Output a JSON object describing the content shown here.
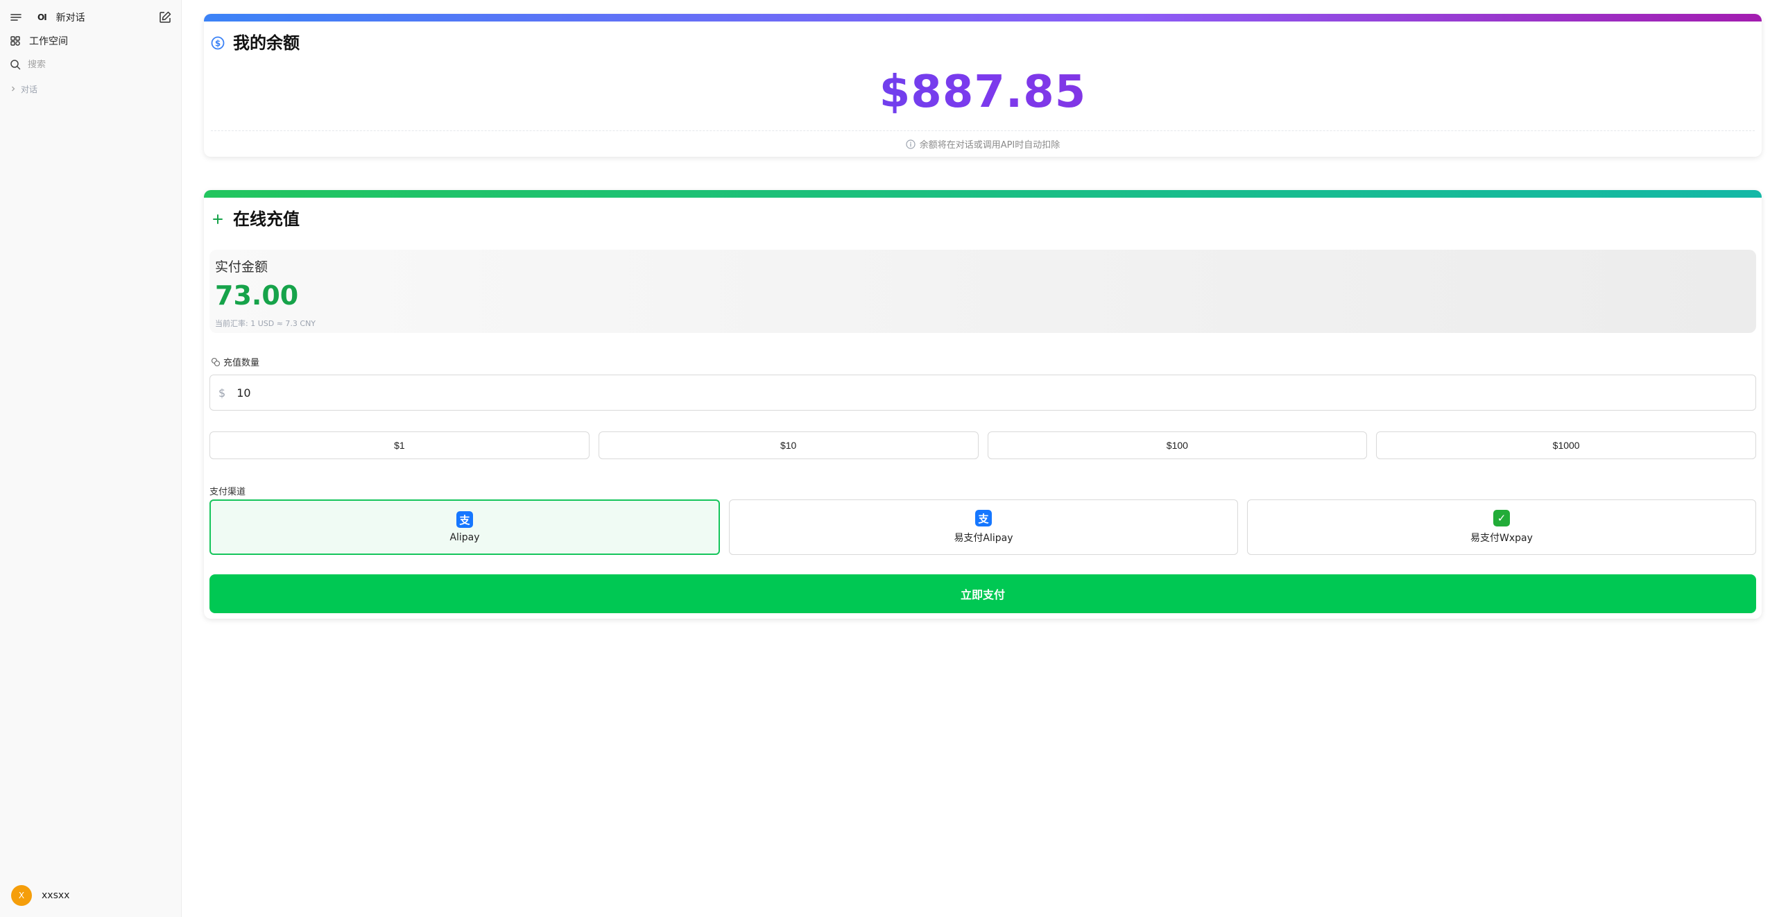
{
  "sidebar": {
    "logo": "OI",
    "new_chat": "新对话",
    "workspace": "工作空间",
    "search_placeholder": "搜索",
    "conversations": "对话",
    "user": {
      "initial": "X",
      "name": "xxsxx"
    }
  },
  "balance": {
    "title": "我的余额",
    "amount": "$887.85",
    "note": "余额将在对话或调用API时自动扣除"
  },
  "recharge": {
    "title": "在线充值",
    "pay_label": "实付金额",
    "pay_amount": "73.00",
    "rate": "当前汇率: 1 USD ≈ 7.3 CNY",
    "qty_label": "充值数量",
    "currency": "$",
    "qty_value": "10",
    "presets": [
      "$1",
      "$10",
      "$100",
      "$1000"
    ],
    "channel_label": "支付渠道",
    "channels": [
      {
        "name": "Alipay",
        "icon": "alipay-icon",
        "color": "#1677ff",
        "glyph": "支",
        "selected": true
      },
      {
        "name": "易支付Alipay",
        "icon": "alipay-icon",
        "color": "#1677ff",
        "glyph": "支",
        "selected": false
      },
      {
        "name": "易支付Wxpay",
        "icon": "wechat-pay-icon",
        "color": "#22ac38",
        "glyph": "✓",
        "selected": false
      }
    ],
    "pay_button": "立即支付"
  },
  "colors": {
    "accent_green": "#00c853",
    "balance_gradient": [
      "#2563eb",
      "#7c3aed",
      "#a21caf"
    ],
    "amount_green": "#16a34a",
    "avatar": "#f59e0b"
  }
}
